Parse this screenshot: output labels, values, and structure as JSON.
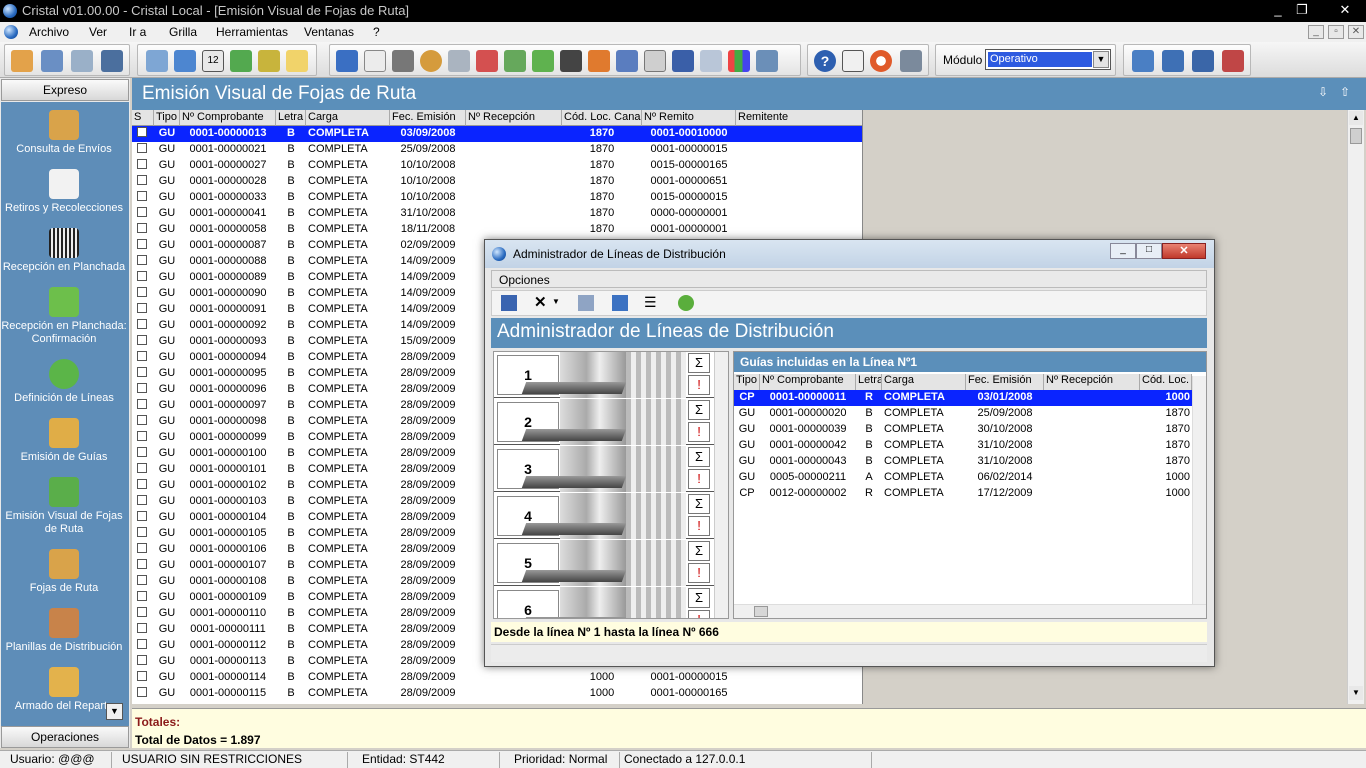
{
  "app_title": "Cristal v01.00.00 - Cristal Local - [Emisión Visual de Fojas de Ruta]",
  "menu": [
    "Archivo",
    "Ver",
    "Ir a",
    "Grilla",
    "Herramientas",
    "Ventanas",
    "?"
  ],
  "toolbar": {
    "modulo_label": "Módulo",
    "modulo_value": "Operativo"
  },
  "sidebar": {
    "top": "Expreso",
    "bottom": "Operaciones",
    "items": [
      {
        "label": "Consulta de Envíos"
      },
      {
        "label": "Retiros y Recolecciones"
      },
      {
        "label": "Recepción en Planchada"
      },
      {
        "label": "Recepción en Planchada: Confirmación"
      },
      {
        "label": "Definición de Líneas"
      },
      {
        "label": "Emisión de Guías"
      },
      {
        "label": "Emisión Visual de Fojas de Ruta"
      },
      {
        "label": "Fojas de Ruta"
      },
      {
        "label": "Planillas de Distribución"
      },
      {
        "label": "Armado del Reparto"
      }
    ]
  },
  "main": {
    "title": "Emisión Visual de Fojas de Ruta",
    "columns": [
      "S",
      "Tipo",
      "Nº Comprobante",
      "Letra",
      "Carga",
      "Fec. Emisión",
      "Nº Recepción",
      "Cód. Loc. Canal",
      "Nº Remito",
      "Remitente"
    ],
    "rows": [
      [
        "GU",
        "0001-00000013",
        "B",
        "COMPLETA",
        "03/09/2008",
        "",
        "1870",
        "0001-00010000"
      ],
      [
        "GU",
        "0001-00000021",
        "B",
        "COMPLETA",
        "25/09/2008",
        "",
        "1870",
        "0001-00000015"
      ],
      [
        "GU",
        "0001-00000027",
        "B",
        "COMPLETA",
        "10/10/2008",
        "",
        "1870",
        "0015-00000165"
      ],
      [
        "GU",
        "0001-00000028",
        "B",
        "COMPLETA",
        "10/10/2008",
        "",
        "1870",
        "0001-00000651"
      ],
      [
        "GU",
        "0001-00000033",
        "B",
        "COMPLETA",
        "10/10/2008",
        "",
        "1870",
        "0015-00000015"
      ],
      [
        "GU",
        "0001-00000041",
        "B",
        "COMPLETA",
        "31/10/2008",
        "",
        "1870",
        "0000-00000001"
      ],
      [
        "GU",
        "0001-00000058",
        "B",
        "COMPLETA",
        "18/11/2008",
        "",
        "1870",
        "0001-00000001"
      ],
      [
        "GU",
        "0001-00000087",
        "B",
        "COMPLETA",
        "02/09/2009",
        "",
        "",
        ""
      ],
      [
        "GU",
        "0001-00000088",
        "B",
        "COMPLETA",
        "14/09/2009",
        "",
        "",
        ""
      ],
      [
        "GU",
        "0001-00000089",
        "B",
        "COMPLETA",
        "14/09/2009",
        "",
        "",
        ""
      ],
      [
        "GU",
        "0001-00000090",
        "B",
        "COMPLETA",
        "14/09/2009",
        "",
        "",
        ""
      ],
      [
        "GU",
        "0001-00000091",
        "B",
        "COMPLETA",
        "14/09/2009",
        "",
        "",
        ""
      ],
      [
        "GU",
        "0001-00000092",
        "B",
        "COMPLETA",
        "14/09/2009",
        "",
        "",
        ""
      ],
      [
        "GU",
        "0001-00000093",
        "B",
        "COMPLETA",
        "15/09/2009",
        "",
        "",
        ""
      ],
      [
        "GU",
        "0001-00000094",
        "B",
        "COMPLETA",
        "28/09/2009",
        "",
        "",
        ""
      ],
      [
        "GU",
        "0001-00000095",
        "B",
        "COMPLETA",
        "28/09/2009",
        "",
        "",
        ""
      ],
      [
        "GU",
        "0001-00000096",
        "B",
        "COMPLETA",
        "28/09/2009",
        "",
        "",
        ""
      ],
      [
        "GU",
        "0001-00000097",
        "B",
        "COMPLETA",
        "28/09/2009",
        "",
        "",
        ""
      ],
      [
        "GU",
        "0001-00000098",
        "B",
        "COMPLETA",
        "28/09/2009",
        "",
        "",
        ""
      ],
      [
        "GU",
        "0001-00000099",
        "B",
        "COMPLETA",
        "28/09/2009",
        "",
        "",
        ""
      ],
      [
        "GU",
        "0001-00000100",
        "B",
        "COMPLETA",
        "28/09/2009",
        "",
        "",
        ""
      ],
      [
        "GU",
        "0001-00000101",
        "B",
        "COMPLETA",
        "28/09/2009",
        "",
        "",
        ""
      ],
      [
        "GU",
        "0001-00000102",
        "B",
        "COMPLETA",
        "28/09/2009",
        "",
        "",
        ""
      ],
      [
        "GU",
        "0001-00000103",
        "B",
        "COMPLETA",
        "28/09/2009",
        "",
        "",
        ""
      ],
      [
        "GU",
        "0001-00000104",
        "B",
        "COMPLETA",
        "28/09/2009",
        "",
        "",
        ""
      ],
      [
        "GU",
        "0001-00000105",
        "B",
        "COMPLETA",
        "28/09/2009",
        "",
        "",
        ""
      ],
      [
        "GU",
        "0001-00000106",
        "B",
        "COMPLETA",
        "28/09/2009",
        "",
        "",
        ""
      ],
      [
        "GU",
        "0001-00000107",
        "B",
        "COMPLETA",
        "28/09/2009",
        "",
        "",
        ""
      ],
      [
        "GU",
        "0001-00000108",
        "B",
        "COMPLETA",
        "28/09/2009",
        "",
        "",
        ""
      ],
      [
        "GU",
        "0001-00000109",
        "B",
        "COMPLETA",
        "28/09/2009",
        "",
        "",
        ""
      ],
      [
        "GU",
        "0001-00000110",
        "B",
        "COMPLETA",
        "28/09/2009",
        "",
        "",
        ""
      ],
      [
        "GU",
        "0001-00000111",
        "B",
        "COMPLETA",
        "28/09/2009",
        "",
        "",
        ""
      ],
      [
        "GU",
        "0001-00000112",
        "B",
        "COMPLETA",
        "28/09/2009",
        "",
        "",
        ""
      ],
      [
        "GU",
        "0001-00000113",
        "B",
        "COMPLETA",
        "28/09/2009",
        "",
        "",
        ""
      ],
      [
        "GU",
        "0001-00000114",
        "B",
        "COMPLETA",
        "28/09/2009",
        "",
        "1000",
        "0001-00000015"
      ],
      [
        "GU",
        "0001-00000115",
        "B",
        "COMPLETA",
        "28/09/2009",
        "",
        "1000",
        "0001-00000165"
      ]
    ],
    "totals_label": "Totales:",
    "totals_value": "Total de Datos = 1.897"
  },
  "status": [
    "Usuario: @@@",
    "USUARIO SIN RESTRICCIONES",
    "Entidad: ST442",
    "Prioridad: Normal",
    "Conectado a 127.0.0.1"
  ],
  "dialog": {
    "title": "Administrador de Líneas de Distribución",
    "menu": "Opciones",
    "header": "Administrador de Líneas de Distribución",
    "lines": [
      "1",
      "2",
      "3",
      "4",
      "5",
      "6"
    ],
    "sum_symbol": "Σ",
    "guias_title": "Guías incluidas en la Línea Nº1",
    "columns": [
      "Tipo",
      "Nº Comprobante",
      "Letra",
      "Carga",
      "Fec. Emisión",
      "Nº Recepción",
      "Cód. Loc."
    ],
    "rows": [
      [
        "CP",
        "0001-00000011",
        "R",
        "COMPLETA",
        "03/01/2008",
        "",
        "1000"
      ],
      [
        "GU",
        "0001-00000020",
        "B",
        "COMPLETA",
        "25/09/2008",
        "",
        "1870"
      ],
      [
        "GU",
        "0001-00000039",
        "B",
        "COMPLETA",
        "30/10/2008",
        "",
        "1870"
      ],
      [
        "GU",
        "0001-00000042",
        "B",
        "COMPLETA",
        "31/10/2008",
        "",
        "1870"
      ],
      [
        "GU",
        "0001-00000043",
        "B",
        "COMPLETA",
        "31/10/2008",
        "",
        "1870"
      ],
      [
        "GU",
        "0005-00000211",
        "A",
        "COMPLETA",
        "06/02/2014",
        "",
        "1000"
      ],
      [
        "CP",
        "0012-00000002",
        "R",
        "COMPLETA",
        "17/12/2009",
        "",
        "1000"
      ]
    ],
    "footer": "Desde la línea Nº 1 hasta la línea Nº 666"
  }
}
